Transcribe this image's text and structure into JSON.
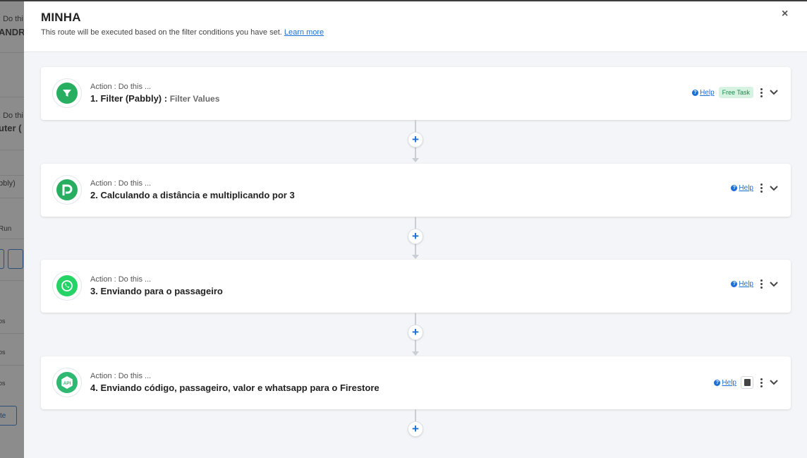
{
  "background": {
    "fragments": [
      ": Do thi",
      "ANDR",
      ": Do thi",
      "uter (",
      "bbly)",
      "Run",
      "os",
      "os",
      "os",
      "te"
    ]
  },
  "modal": {
    "title": "MINHA",
    "subtitle": "This route will be executed based on the filter conditions you have set.",
    "learn_more": "Learn more",
    "close_glyph": "×"
  },
  "steps": [
    {
      "action": "Action : Do this ...",
      "title": "1. Filter (Pabbly) :",
      "subtitle": "Filter Values",
      "help": "Help",
      "badge": "Free Task",
      "icon": "filter-icon",
      "icon_color": "#27ae60"
    },
    {
      "action": "Action : Do this ...",
      "title": "2. Calculando a distância e multiplicando por 3",
      "help": "Help",
      "icon": "pabbly-icon",
      "icon_color": "#27ae60"
    },
    {
      "action": "Action : Do this ...",
      "title": "3. Enviando para o passageiro",
      "help": "Help",
      "icon": "whatsapp-icon",
      "icon_color": "#25d366"
    },
    {
      "action": "Action : Do this ...",
      "title": "4. Enviando código, passageiro, valor e whatsapp para o Firestore",
      "help": "Help",
      "icon": "api-icon",
      "icon_color": "#2eb872"
    }
  ],
  "add_step_glyph": "+"
}
